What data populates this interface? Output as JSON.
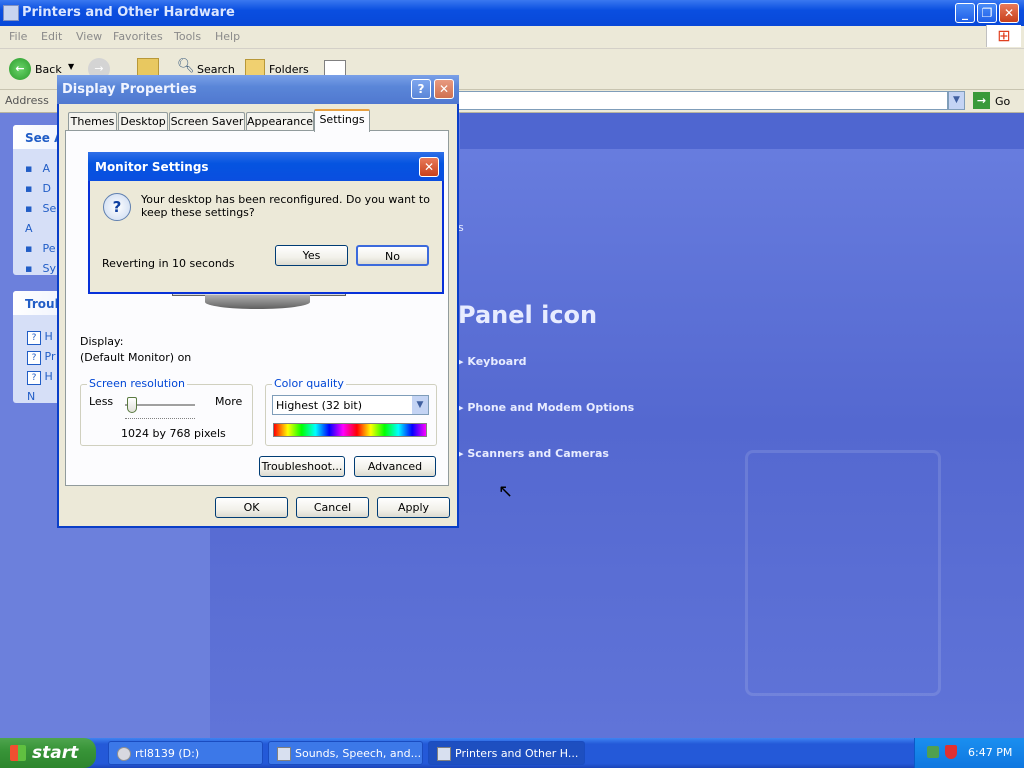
{
  "window": {
    "title": "Printers and Other Hardware"
  },
  "menu": [
    "File",
    "Edit",
    "View",
    "Favorites",
    "Tools",
    "Help"
  ],
  "toolbar": {
    "back": "Back",
    "search": "Search",
    "folders": "Folders"
  },
  "addressbar": {
    "label": "Address",
    "go": "Go"
  },
  "leftpane": {
    "see_also_title": "See A",
    "troubleshoot_title": "Troub",
    "see_items": [
      "A",
      "D",
      "Se\nA",
      "Pe",
      "Sy"
    ],
    "trouble_items": [
      "H",
      "Pr",
      "H\nN"
    ]
  },
  "content": {
    "panel_icon_title": "Panel icon",
    "s_fragment": "s",
    "items": [
      "Keyboard",
      "Phone and Modem Options",
      "Scanners and Cameras"
    ]
  },
  "display_properties": {
    "title": "Display Properties",
    "tabs": [
      "Themes",
      "Desktop",
      "Screen Saver",
      "Appearance",
      "Settings"
    ],
    "active_tab": "Settings",
    "display_label": "Display:",
    "display_value": "(Default Monitor) on",
    "screen_resolution": {
      "label": "Screen resolution",
      "less": "Less",
      "more": "More",
      "value": "1024 by 768 pixels",
      "slider_position": 0.1
    },
    "color_quality": {
      "label": "Color quality",
      "selected": "Highest (32 bit)"
    },
    "buttons": {
      "troubleshoot": "Troubleshoot...",
      "advanced": "Advanced",
      "ok": "OK",
      "cancel": "Cancel",
      "apply": "Apply"
    }
  },
  "monitor_settings": {
    "title": "Monitor Settings",
    "message": "Your desktop has been reconfigured.  Do you want to keep these settings?",
    "countdown": "Reverting in 10 seconds",
    "yes": "Yes",
    "no": "No"
  },
  "taskbar": {
    "start": "start",
    "tasks": [
      "rtl8139 (D:)",
      "Sounds, Speech, and...",
      "Printers and Other H..."
    ],
    "active_task": 2,
    "clock": "6:47 PM"
  },
  "colors": {
    "xp_blue": "#0a4ee0",
    "dialog_bg": "#ece9d8",
    "content_blue": "#5a6fd6",
    "start_green": "#389438"
  }
}
